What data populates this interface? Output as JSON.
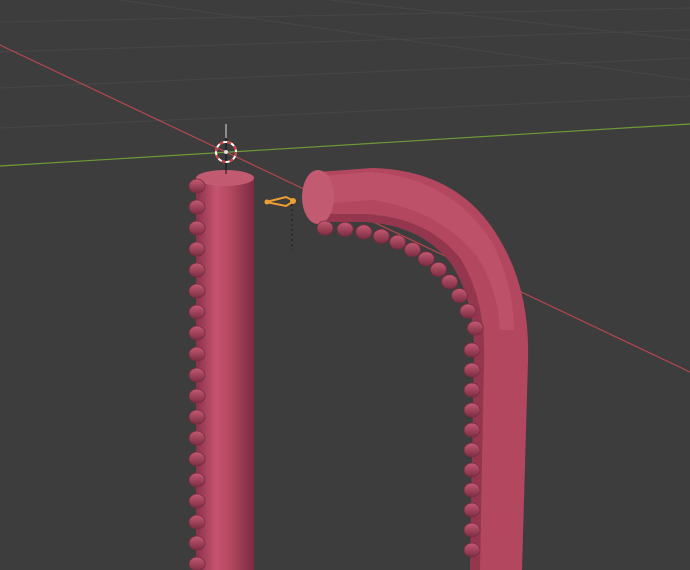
{
  "viewport": {
    "background": "#3d3d3d",
    "grid_color": "#4a4a4a",
    "axis_x_color": "#b4474e",
    "axis_y_color": "#6e9a37"
  },
  "objects": {
    "straight_tentacle": {
      "color": "#b3475f",
      "shadow": "#7e2d42",
      "highlight": "#cf6a80"
    },
    "bent_tentacle": {
      "color": "#b3475f",
      "shadow": "#7e2d42",
      "highlight": "#cf6a80"
    },
    "armature_bone": {
      "color": "#f0a030"
    },
    "cursor_3d": {
      "ring_color": "#d63a3a",
      "ring_alt_color": "#ffffff"
    }
  }
}
